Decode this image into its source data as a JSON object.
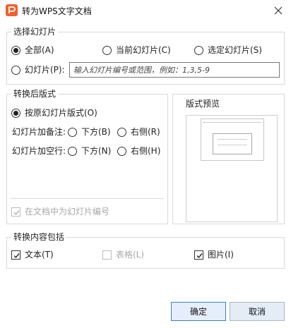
{
  "window": {
    "title": "转为WPS文字文档",
    "logo_letter": "P",
    "accent_color": "#f0602e"
  },
  "slide_selection": {
    "legend": "选择幻灯片",
    "options": [
      {
        "label": "全部(A)",
        "checked": true
      },
      {
        "label": "当前幻灯片(C)",
        "checked": false
      },
      {
        "label": "选定幻灯片(S)",
        "checked": false
      },
      {
        "label": "幻灯片(P):",
        "checked": false
      }
    ],
    "range_placeholder": "输入幻灯片编号或范围，例如：1,3,5-9"
  },
  "layout": {
    "legend": "转换后版式",
    "original_layout_label": "按原幻灯片版式(O)",
    "original_layout_checked": true,
    "notes_row_label": "幻灯片加备注:",
    "notes_below_label": "下方(B)",
    "notes_right_label": "右侧(R)",
    "blank_row_label": "幻灯片加空行:",
    "blank_below_label": "下方(N)",
    "blank_right_label": "右侧(H)",
    "number_checkbox_label": "在文档中为幻灯片编号",
    "number_checkbox_checked": true,
    "number_checkbox_disabled": true
  },
  "preview": {
    "legend": "版式预览"
  },
  "content": {
    "legend": "转换内容包括",
    "text_label": "文本(T)",
    "text_checked": true,
    "table_label": "表格(L)",
    "table_checked": false,
    "table_disabled": true,
    "image_label": "图片(I)",
    "image_checked": true
  },
  "buttons": {
    "ok": "确定",
    "cancel": "取消"
  }
}
